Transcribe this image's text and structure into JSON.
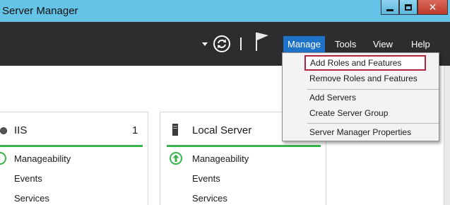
{
  "window": {
    "title": "Server Manager",
    "controls": {
      "minimize": "minimize",
      "maximize": "maximize",
      "close": "✕"
    }
  },
  "toolbar": {
    "menus": [
      "Manage",
      "Tools",
      "View",
      "Help"
    ],
    "active_menu": "Manage",
    "icons": [
      "dropdown-arrow-icon",
      "refresh-icon",
      "flag-icon"
    ]
  },
  "manage_menu": {
    "items": [
      {
        "label": "Add Roles and Features",
        "highlighted": true
      },
      {
        "label": "Remove Roles and Features"
      },
      {
        "label": "Add Servers"
      },
      {
        "label": "Create Server Group"
      },
      {
        "label": "Server Manager Properties"
      }
    ]
  },
  "tiles": [
    {
      "title": "IIS",
      "count": "1",
      "rows": [
        "Manageability",
        "Events",
        "Services"
      ]
    },
    {
      "title": "Local Server",
      "rows": [
        "Manageability",
        "Events",
        "Services"
      ]
    }
  ],
  "colors": {
    "titlebar": "#66c3e8",
    "commandbar": "#2d2d30",
    "menu_active": "#1e73c9",
    "status_ok": "#37b44a",
    "highlight_border": "#b3253a"
  }
}
